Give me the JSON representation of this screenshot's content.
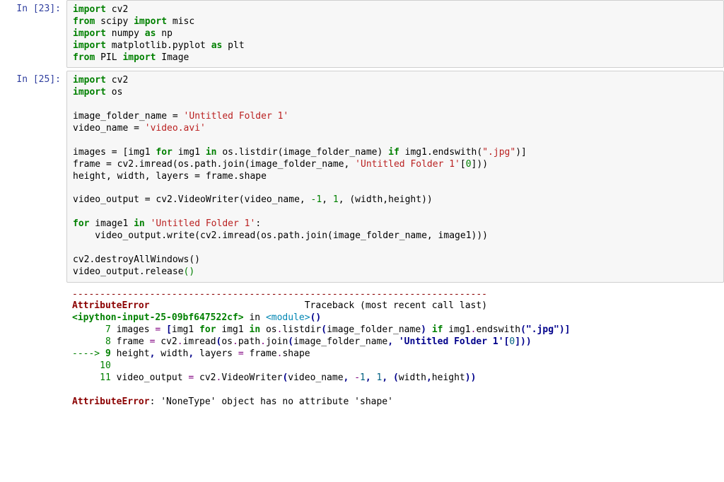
{
  "cells": {
    "cell1": {
      "prompt": "In [23]:",
      "tokens": {
        "l1_import": "import",
        "l1_cv2": " cv2",
        "l2_from": "from",
        "l2_scipy": " scipy ",
        "l2_import": "import",
        "l2_misc": " misc",
        "l3_import": "import",
        "l3_numpy": " numpy ",
        "l3_as": "as",
        "l3_np": " np",
        "l4_import": "import",
        "l4_mpl": " matplotlib.pyplot ",
        "l4_as": "as",
        "l4_plt": " plt",
        "l5_from": "from",
        "l5_pil": " PIL ",
        "l5_import": "import",
        "l5_image": " Image"
      }
    },
    "cell2": {
      "prompt": "In [25]:",
      "tokens": {
        "l1_import": "import",
        "l1_cv2": " cv2",
        "l2_import": "import",
        "l2_os": " os",
        "l3_blank": "",
        "l4_pre": "image_folder_name = ",
        "l4_str": "'Untitled Folder 1'",
        "l5_pre": "video_name = ",
        "l5_str": "'video.avi'",
        "l6_blank": "",
        "l7_a": "images = [img1 ",
        "l7_for": "for",
        "l7_b": " img1 ",
        "l7_in": "in",
        "l7_c": " os.listdir(image_folder_name) ",
        "l7_if": "if",
        "l7_d": " img1.endswith(",
        "l7_str": "\".jpg\"",
        "l7_e": ")]",
        "l8_a": "frame = cv2.imread(os.path.join(image_folder_name, ",
        "l8_str": "'Untitled Folder 1'",
        "l8_b": "[",
        "l8_num": "0",
        "l8_c": "]))",
        "l9": "height, width, layers = frame.shape",
        "l10_blank": "",
        "l11_a": "video_output = cv2.VideoWriter(video_name, ",
        "l11_n1": "-1",
        "l11_b": ", ",
        "l11_n2": "1",
        "l11_c": ", (width,height))",
        "l12_blank": "",
        "l13_for": "for",
        "l13_a": " image1 ",
        "l13_in": "in",
        "l13_b": " ",
        "l13_str": "'Untitled Folder 1'",
        "l13_c": ":",
        "l14": "    video_output.write(cv2.imread(os.path.join(image_folder_name, image1)))",
        "l15_blank": "",
        "l16": "cv2.destroyAllWindows()",
        "l17_a": "video_output.release",
        "l17_paren": "()"
      },
      "traceback": {
        "dash": "---------------------------------------------------------------------------",
        "err_name": "AttributeError",
        "err_spacer": "                            ",
        "err_trace": "Traceback (most recent call last)",
        "ipyin": "<ipython-input-25-09bf647522cf>",
        "in_txt": " in ",
        "module": "<module>",
        "parens": "()",
        "l7_indent": "      ",
        "l7_num": "7",
        "l7_a": " images ",
        "l7_eq": "=",
        "l7_b": " ",
        "l7_ob": "[",
        "l7_c": "img1 ",
        "l7_for": "for",
        "l7_d": " img1 ",
        "l7_in": "in",
        "l7_e": " os",
        "l7_dot1": ".",
        "l7_f": "listdir",
        "l7_op": "(",
        "l7_g": "image_folder_name",
        "l7_cp": ")",
        "l7_sp": " ",
        "l7_if": "if",
        "l7_h": " img1",
        "l7_dot2": ".",
        "l7_i": "endswith",
        "l7_op2": "(",
        "l7_str": "\".jpg\"",
        "l7_cpcb": ")]",
        "l8_indent": "      ",
        "l8_num": "8",
        "l8_a": " frame ",
        "l8_eq": "=",
        "l8_b": " cv2",
        "l8_dot1": ".",
        "l8_c": "imread",
        "l8_op": "(",
        "l8_d": "os",
        "l8_dot2": ".",
        "l8_e": "path",
        "l8_dot3": ".",
        "l8_f": "join",
        "l8_op2": "(",
        "l8_g": "image_folder_name",
        "l8_com": ",",
        "l8_sp": " ",
        "l8_str": "'Untitled Folder 1'",
        "l8_ob": "[",
        "l8_n": "0",
        "l8_cbcpcp": "]))",
        "l9_arrow": "----> ",
        "l9_num": "9",
        "l9_a": " height",
        "l9_com1": ",",
        "l9_b": " width",
        "l9_com2": ",",
        "l9_c": " layers ",
        "l9_eq": "=",
        "l9_d": " frame",
        "l9_dot": ".",
        "l9_e": "shape",
        "l10_indent": "     ",
        "l10_num": "10",
        "l11_indent": "     ",
        "l11_num": "11",
        "l11_a": " video_output ",
        "l11_eq": "=",
        "l11_b": " cv2",
        "l11_dot": ".",
        "l11_c": "VideoWriter",
        "l11_op": "(",
        "l11_d": "video_name",
        "l11_com1": ",",
        "l11_e": " ",
        "l11_n1": "-",
        "l11_n1b": "1",
        "l11_com2": ",",
        "l11_f": " ",
        "l11_n2": "1",
        "l11_com3": ",",
        "l11_g": " ",
        "l11_op2": "(",
        "l11_h": "width",
        "l11_com4": ",",
        "l11_i": "height",
        "l11_cpcp": "))",
        "blank": "",
        "final_err": "AttributeError",
        "final_msg": ": 'NoneType' object has no attribute 'shape'"
      }
    }
  }
}
